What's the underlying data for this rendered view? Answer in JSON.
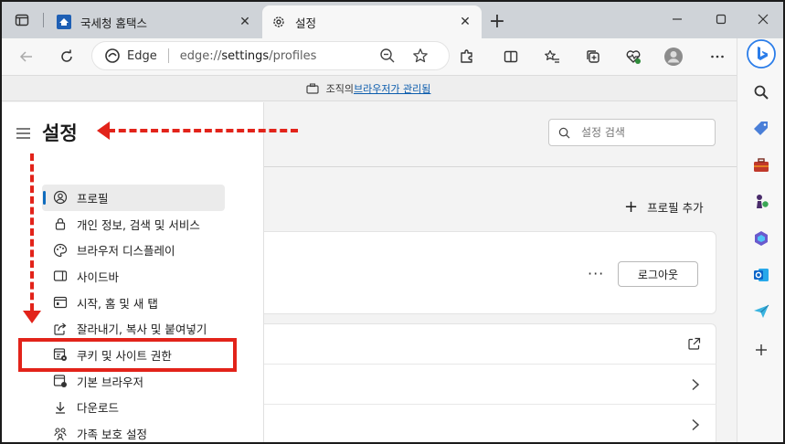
{
  "tabs": [
    {
      "title": "국세청 홈택스",
      "active": false
    },
    {
      "title": "설정",
      "active": true
    }
  ],
  "window_controls": {
    "minimize": "—",
    "maximize": "☐",
    "close": "✕"
  },
  "address_bar": {
    "brand": "Edge",
    "url_prefix": "edge://",
    "url_bold": "settings",
    "url_suffix": "/profiles"
  },
  "banner": {
    "prefix": "조직의 ",
    "link": "브라우저가 관리됨"
  },
  "settings": {
    "title": "설정",
    "search_placeholder": "설정 검색",
    "nav": [
      {
        "label": "프로필",
        "selected": true,
        "icon": "profile-icon"
      },
      {
        "label": "개인 정보, 검색 및 서비스",
        "selected": false,
        "icon": "lock-icon"
      },
      {
        "label": "브라우저 디스플레이",
        "selected": false,
        "icon": "palette-icon"
      },
      {
        "label": "사이드바",
        "selected": false,
        "icon": "sidebar-icon"
      },
      {
        "label": "시작, 홈 및 새 탭",
        "selected": false,
        "icon": "home-tab-icon"
      },
      {
        "label": "잘라내기, 복사 및 붙여넣기",
        "selected": false,
        "icon": "share-icon"
      },
      {
        "label": "쿠키 및 사이트 권한",
        "selected": false,
        "icon": "cookie-icon"
      },
      {
        "label": "기본 브라우저",
        "selected": false,
        "icon": "browser-icon"
      },
      {
        "label": "다운로드",
        "selected": false,
        "icon": "download-icon"
      },
      {
        "label": "가족 보호 설정",
        "selected": false,
        "icon": "family-icon"
      }
    ],
    "add_profile": "프로필 추가",
    "more": "···",
    "logout": "로그아웃"
  },
  "colors": {
    "accent": "#0f6cbd",
    "annotation": "#e2231a"
  }
}
